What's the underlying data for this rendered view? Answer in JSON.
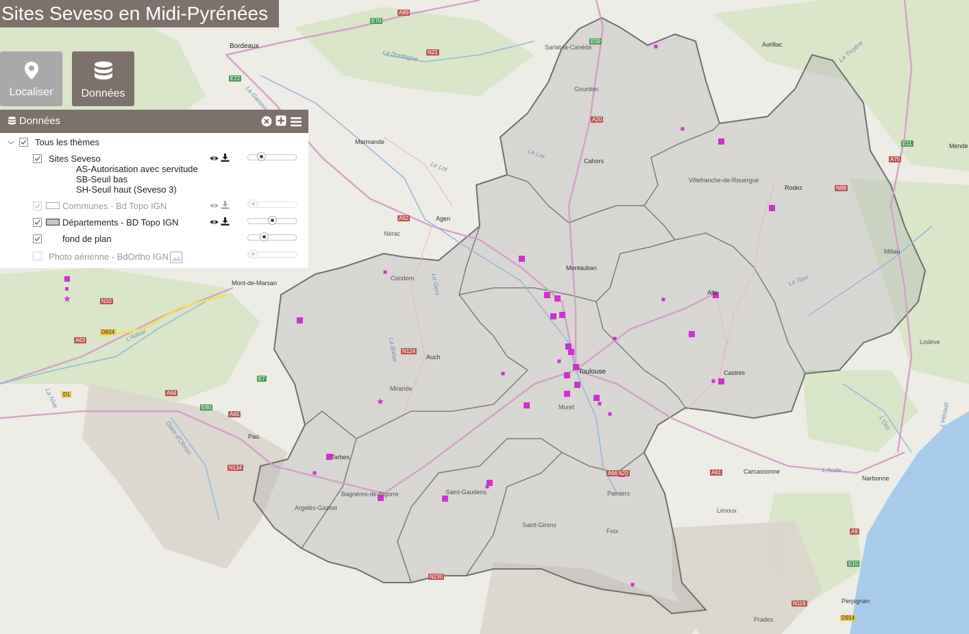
{
  "app": {
    "title": "Sites Seveso en Midi-Pyrénées"
  },
  "toolbar": {
    "localiser_label": "Localiser",
    "donnees_label": "Données"
  },
  "panel": {
    "title": "Données",
    "root": {
      "label": "Tous les thèmes",
      "checked": true
    },
    "layers": [
      {
        "label": "Sites Seveso",
        "checked": true,
        "enabled": true,
        "opacity": 0.27
      },
      {
        "label": "Communes - Bd Topo IGN",
        "checked": true,
        "enabled": false,
        "opacity": 0.1
      },
      {
        "label": "Départements - BD Topo IGN",
        "checked": true,
        "enabled": true,
        "opacity": 0.5
      },
      {
        "label": "fond de plan",
        "checked": true,
        "enabled": true,
        "opacity": 0.33
      },
      {
        "label": "Photo aérienne - BdOrtho IGN",
        "checked": false,
        "enabled": false,
        "opacity": 0.1
      }
    ],
    "legend": [
      {
        "symbol": "square",
        "label": "AS-Autorisation avec servitude"
      },
      {
        "symbol": "small-square",
        "label": "SB-Seuil bas"
      },
      {
        "symbol": "star",
        "label": "SH-Seuil haut (Seveso 3)"
      }
    ]
  },
  "map": {
    "colors": {
      "site": "#cc33cc",
      "region_fill": "#b4b4b4",
      "border": "#6e6e6e",
      "sea": "#a9cbea"
    },
    "place_labels": [
      "Bordeaux",
      "Aurillac",
      "Sarlat-la-Canéda",
      "Gourdon",
      "Marmande",
      "Cahors",
      "Mende",
      "Villefranche-de-Rouergue",
      "Rodez",
      "Agen",
      "Nérac",
      "Montauban",
      "Millau",
      "Condom",
      "Albi",
      "Mont-de-Marsan",
      "Lodève",
      "Auch",
      "Toulouse",
      "Castres",
      "Mirande",
      "Muret",
      "Pau",
      "Tarbes",
      "Carcassonne",
      "Narbonne",
      "Saint-Gaudens",
      "Bagnères-de-Bigorre",
      "Pamiers",
      "Limoux",
      "Argelès-Gazost",
      "Saint-Girons",
      "Foix",
      "Perpignan",
      "Prades"
    ],
    "road_labels": [
      "A89",
      "E70",
      "N21",
      "E72",
      "A62",
      "A20",
      "A75",
      "N88",
      "E11",
      "E7",
      "N124",
      "N10",
      "D824",
      "A63",
      "A64",
      "A65",
      "D1",
      "E80",
      "N134",
      "A61",
      "A9",
      "E15",
      "N20",
      "N116",
      "D914",
      "N230",
      "A66",
      "E09"
    ],
    "river_labels": [
      "La Dordogne",
      "Le Lot",
      "L'Adour",
      "La Truyère",
      "Le Tarn",
      "Le Gers",
      "La Garonne",
      "L'Orb",
      "L'Aude",
      "L'Hérault",
      "Le Lot",
      "La Baïse",
      "Gave d'Oloron",
      "La Nive"
    ]
  }
}
